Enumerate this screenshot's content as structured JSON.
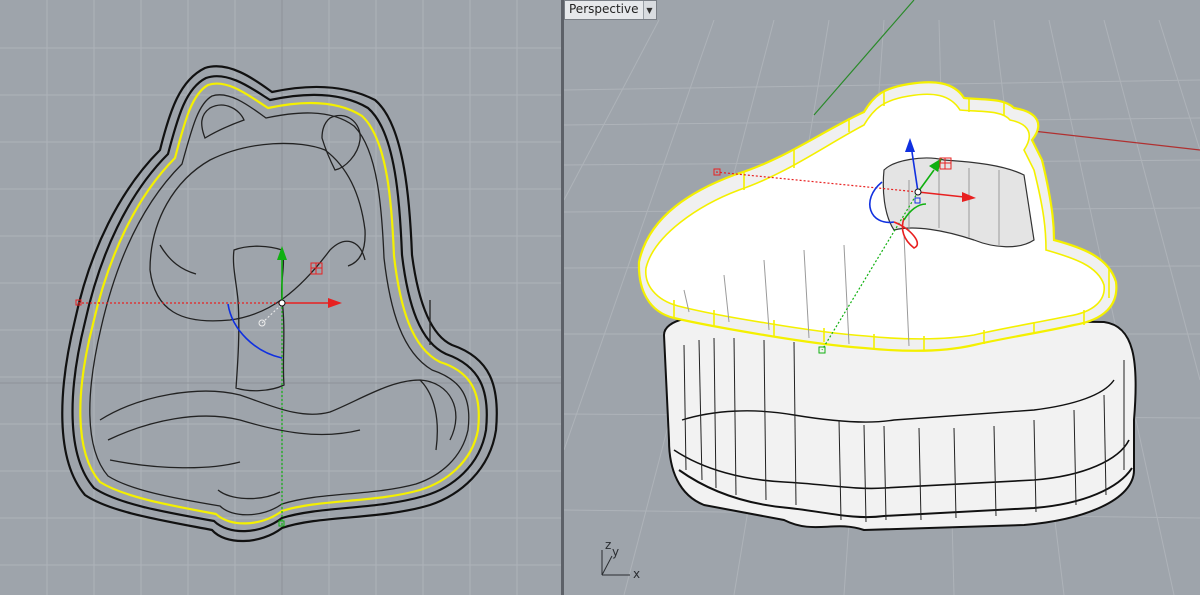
{
  "viewports": {
    "top": {
      "name": ""
    },
    "perspective": {
      "name": "Perspective",
      "menu_icon": "chevron-down-icon"
    }
  },
  "axis_triad": {
    "z": "z",
    "y": "y",
    "x": "x"
  },
  "colors": {
    "viewport_bg": "#9ea4ab",
    "grid_minor": "#aeb3b9",
    "grid_major": "#8d9298",
    "selection_yellow": "#f4f000",
    "gumball_x": "#e82020",
    "gumball_y": "#10b010",
    "gumball_z": "#1030e0",
    "world_x_axis": "#b03030",
    "world_y_axis": "#2a8a2a"
  }
}
